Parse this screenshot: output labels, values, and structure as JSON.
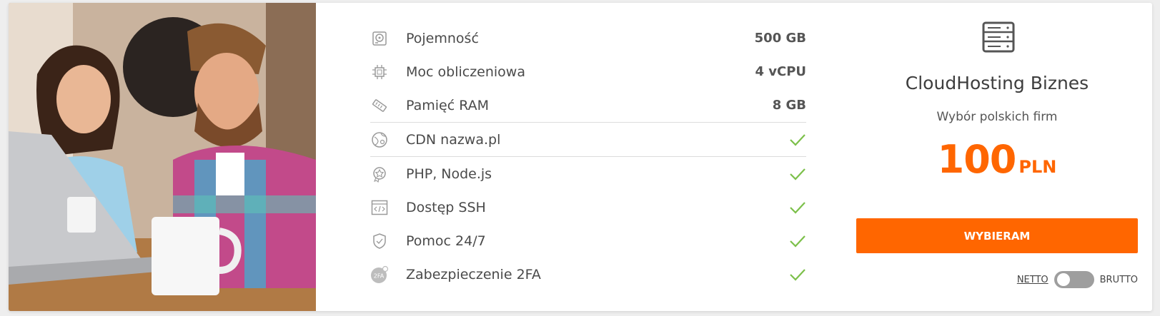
{
  "features": [
    {
      "icon": "hard-drive-icon",
      "label": "Pojemność",
      "value": "500 GB"
    },
    {
      "icon": "cpu-chip-icon",
      "label": "Moc obliczeniowa",
      "value": "4 vCPU"
    },
    {
      "icon": "ram-memory-icon",
      "label": "Pamięć RAM",
      "value": "8 GB"
    },
    {
      "icon": "globe-cdn-icon",
      "label": "CDN nazwa.pl",
      "value": ""
    },
    {
      "icon": "badge-star-icon",
      "label": "PHP, Node.js",
      "value": ""
    },
    {
      "icon": "terminal-code-icon",
      "label": "Dostęp SSH",
      "value": ""
    },
    {
      "icon": "shield-check-icon",
      "label": "Pomoc 24/7",
      "value": ""
    },
    {
      "icon": "twofa-icon",
      "label": "Zabezpieczenie 2FA",
      "value": ""
    }
  ],
  "plan": {
    "title": "CloudHosting Biznes",
    "subtitle": "Wybór polskich firm",
    "price_amount": "100",
    "price_currency": "PLN",
    "button_label": "WYBIERAM",
    "toggle": {
      "left": "NETTO",
      "right": "BRUTTO",
      "selected": "NETTO"
    }
  },
  "colors": {
    "accent": "#ff6600",
    "check": "#7cc04a",
    "toggle": "#9e9e9e"
  }
}
